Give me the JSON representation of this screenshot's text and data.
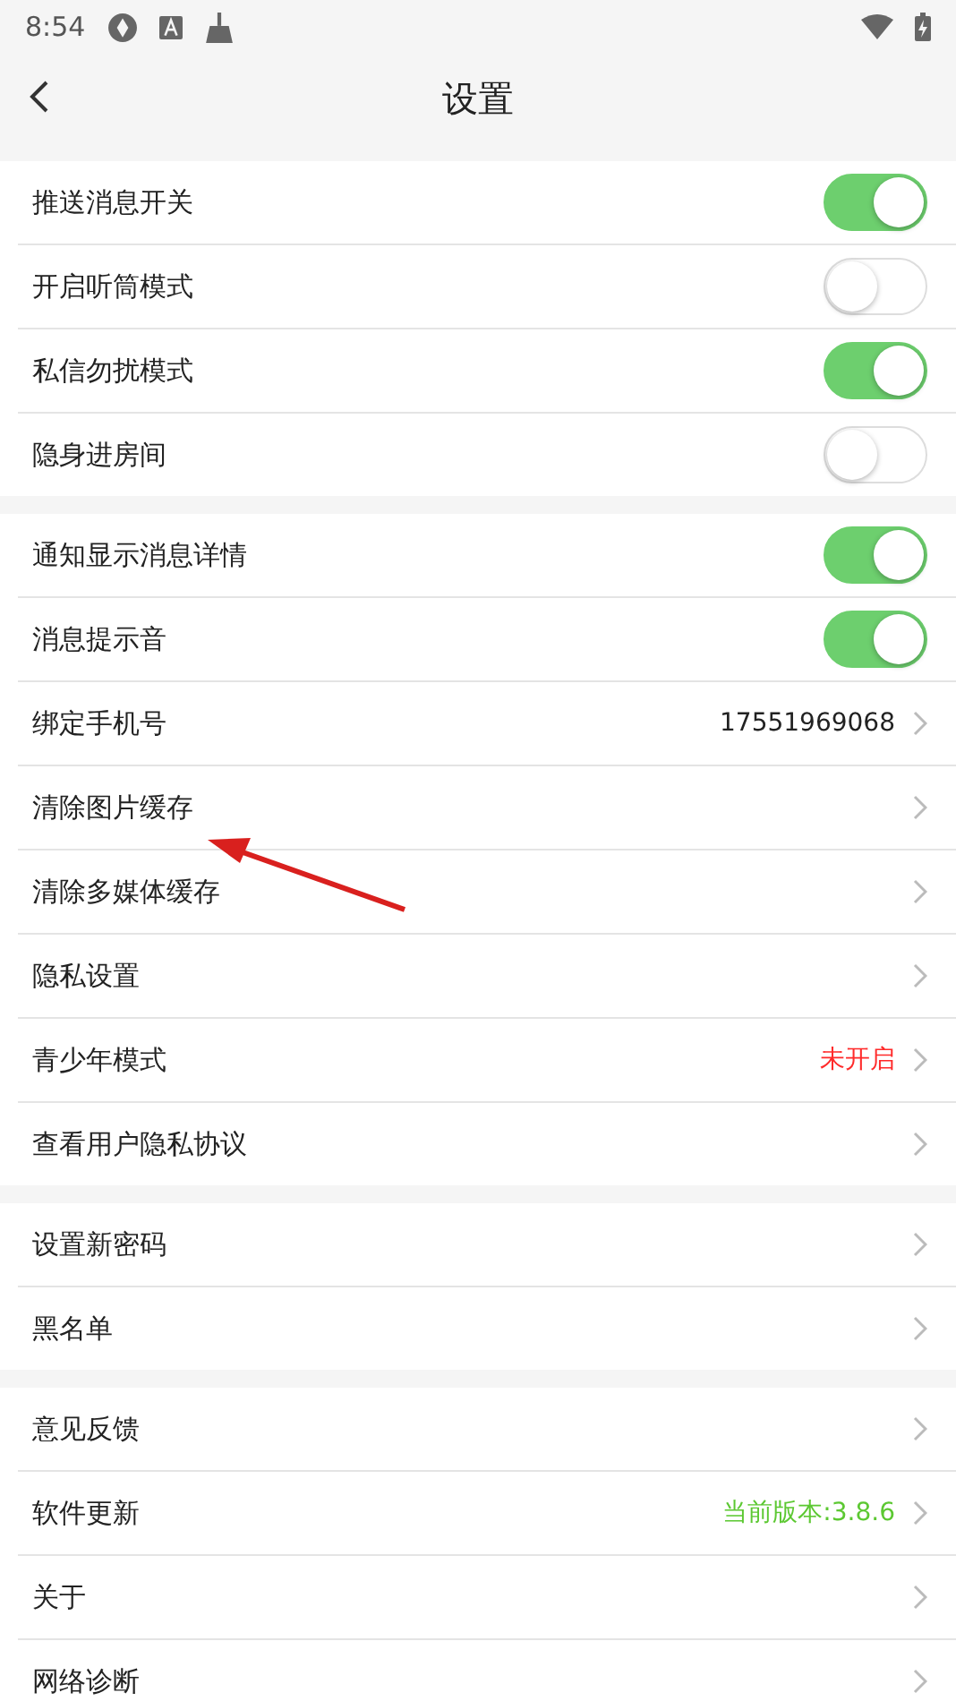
{
  "status_bar": {
    "time": "8:54"
  },
  "header": {
    "title": "设置"
  },
  "groups": [
    {
      "rows": [
        {
          "kind": "toggle",
          "label": "推送消息开关",
          "on": true
        },
        {
          "kind": "toggle",
          "label": "开启听筒模式",
          "on": false
        },
        {
          "kind": "toggle",
          "label": "私信勿扰模式",
          "on": true
        },
        {
          "kind": "toggle",
          "label": "隐身进房间",
          "on": false
        }
      ]
    },
    {
      "rows": [
        {
          "kind": "toggle",
          "label": "通知显示消息详情",
          "on": true
        },
        {
          "kind": "toggle",
          "label": "消息提示音",
          "on": true
        },
        {
          "kind": "nav",
          "label": "绑定手机号",
          "value": "17551969068",
          "color": "#222222"
        },
        {
          "kind": "nav",
          "label": "清除图片缓存"
        },
        {
          "kind": "nav",
          "label": "清除多媒体缓存"
        },
        {
          "kind": "nav",
          "label": "隐私设置"
        },
        {
          "kind": "nav",
          "label": "青少年模式",
          "value": "未开启",
          "color": "#ff2a2a"
        },
        {
          "kind": "nav",
          "label": "查看用户隐私协议"
        }
      ]
    },
    {
      "rows": [
        {
          "kind": "nav",
          "label": "设置新密码"
        },
        {
          "kind": "nav",
          "label": "黑名单"
        }
      ]
    },
    {
      "rows": [
        {
          "kind": "nav",
          "label": "意见反馈"
        },
        {
          "kind": "nav",
          "label": "软件更新",
          "value": "当前版本:3.8.6",
          "color": "#5cc832"
        },
        {
          "kind": "nav",
          "label": "关于"
        },
        {
          "kind": "nav",
          "label": "网络诊断"
        }
      ]
    }
  ]
}
